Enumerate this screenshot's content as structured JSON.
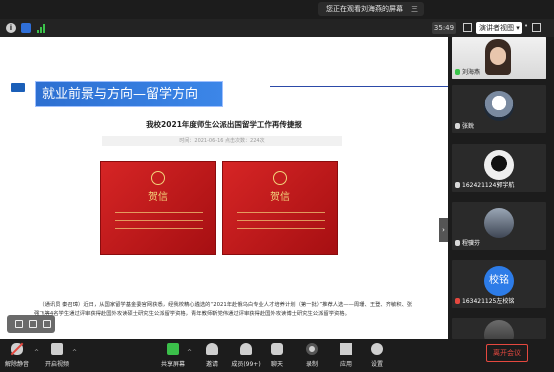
{
  "notice": {
    "text": "您正在观看刘海燕的屏幕",
    "stop": "三"
  },
  "status": {
    "info_glyph": "i",
    "timer": "35:49",
    "view_label": "演讲者视图 ▾",
    "more": "•"
  },
  "screen": {
    "section_title": "就业前景与方向—留学方向",
    "article_title": "我校2021年度师生公派出国留学工作再传捷报",
    "meta": "时间：2021-06-16    点击次数：224次",
    "certificate_title": "贺信",
    "body": "（通讯员 秦召璋）近日，从国家留学基金委官网获悉，经我校精心遴选的“2021年赴俄乌白专业人才培养计划（第一批）”推荐人选——周珊、王登、齐敏积、张强飞等4名学生通过评审获得赴国外攻读硕士研究生公派留学资格，青年教师靳党伟通过评审获得赴国外攻读博士研究生公派留学资格。",
    "side_toggle": "›"
  },
  "participants": [
    {
      "name": "刘海燕",
      "kind": "video",
      "mic": "green"
    },
    {
      "name": "张銳",
      "kind": "avatar",
      "mic": "white"
    },
    {
      "name": "162421124郭宇航",
      "kind": "avatar",
      "mic": "white"
    },
    {
      "name": "程骥芬",
      "kind": "avatar",
      "mic": "white"
    },
    {
      "name": "163421125左校铭",
      "kind": "text-avatar",
      "avatar_text": "校铭",
      "mic": "red"
    },
    {
      "name": "",
      "kind": "avatar",
      "mic": "white"
    }
  ],
  "toolbar": {
    "mute": "解除静音",
    "video": "开启视频",
    "share": "共享屏幕",
    "invite": "邀请",
    "members": "成员(99+)",
    "chat": "聊天",
    "record": "录制",
    "apps": "应用",
    "settings": "设置",
    "leave": "离开会议"
  },
  "colors": {
    "accent_blue": "#2d6fd1",
    "leave_red": "#e5483f",
    "share_green": "#3bbf4a"
  }
}
